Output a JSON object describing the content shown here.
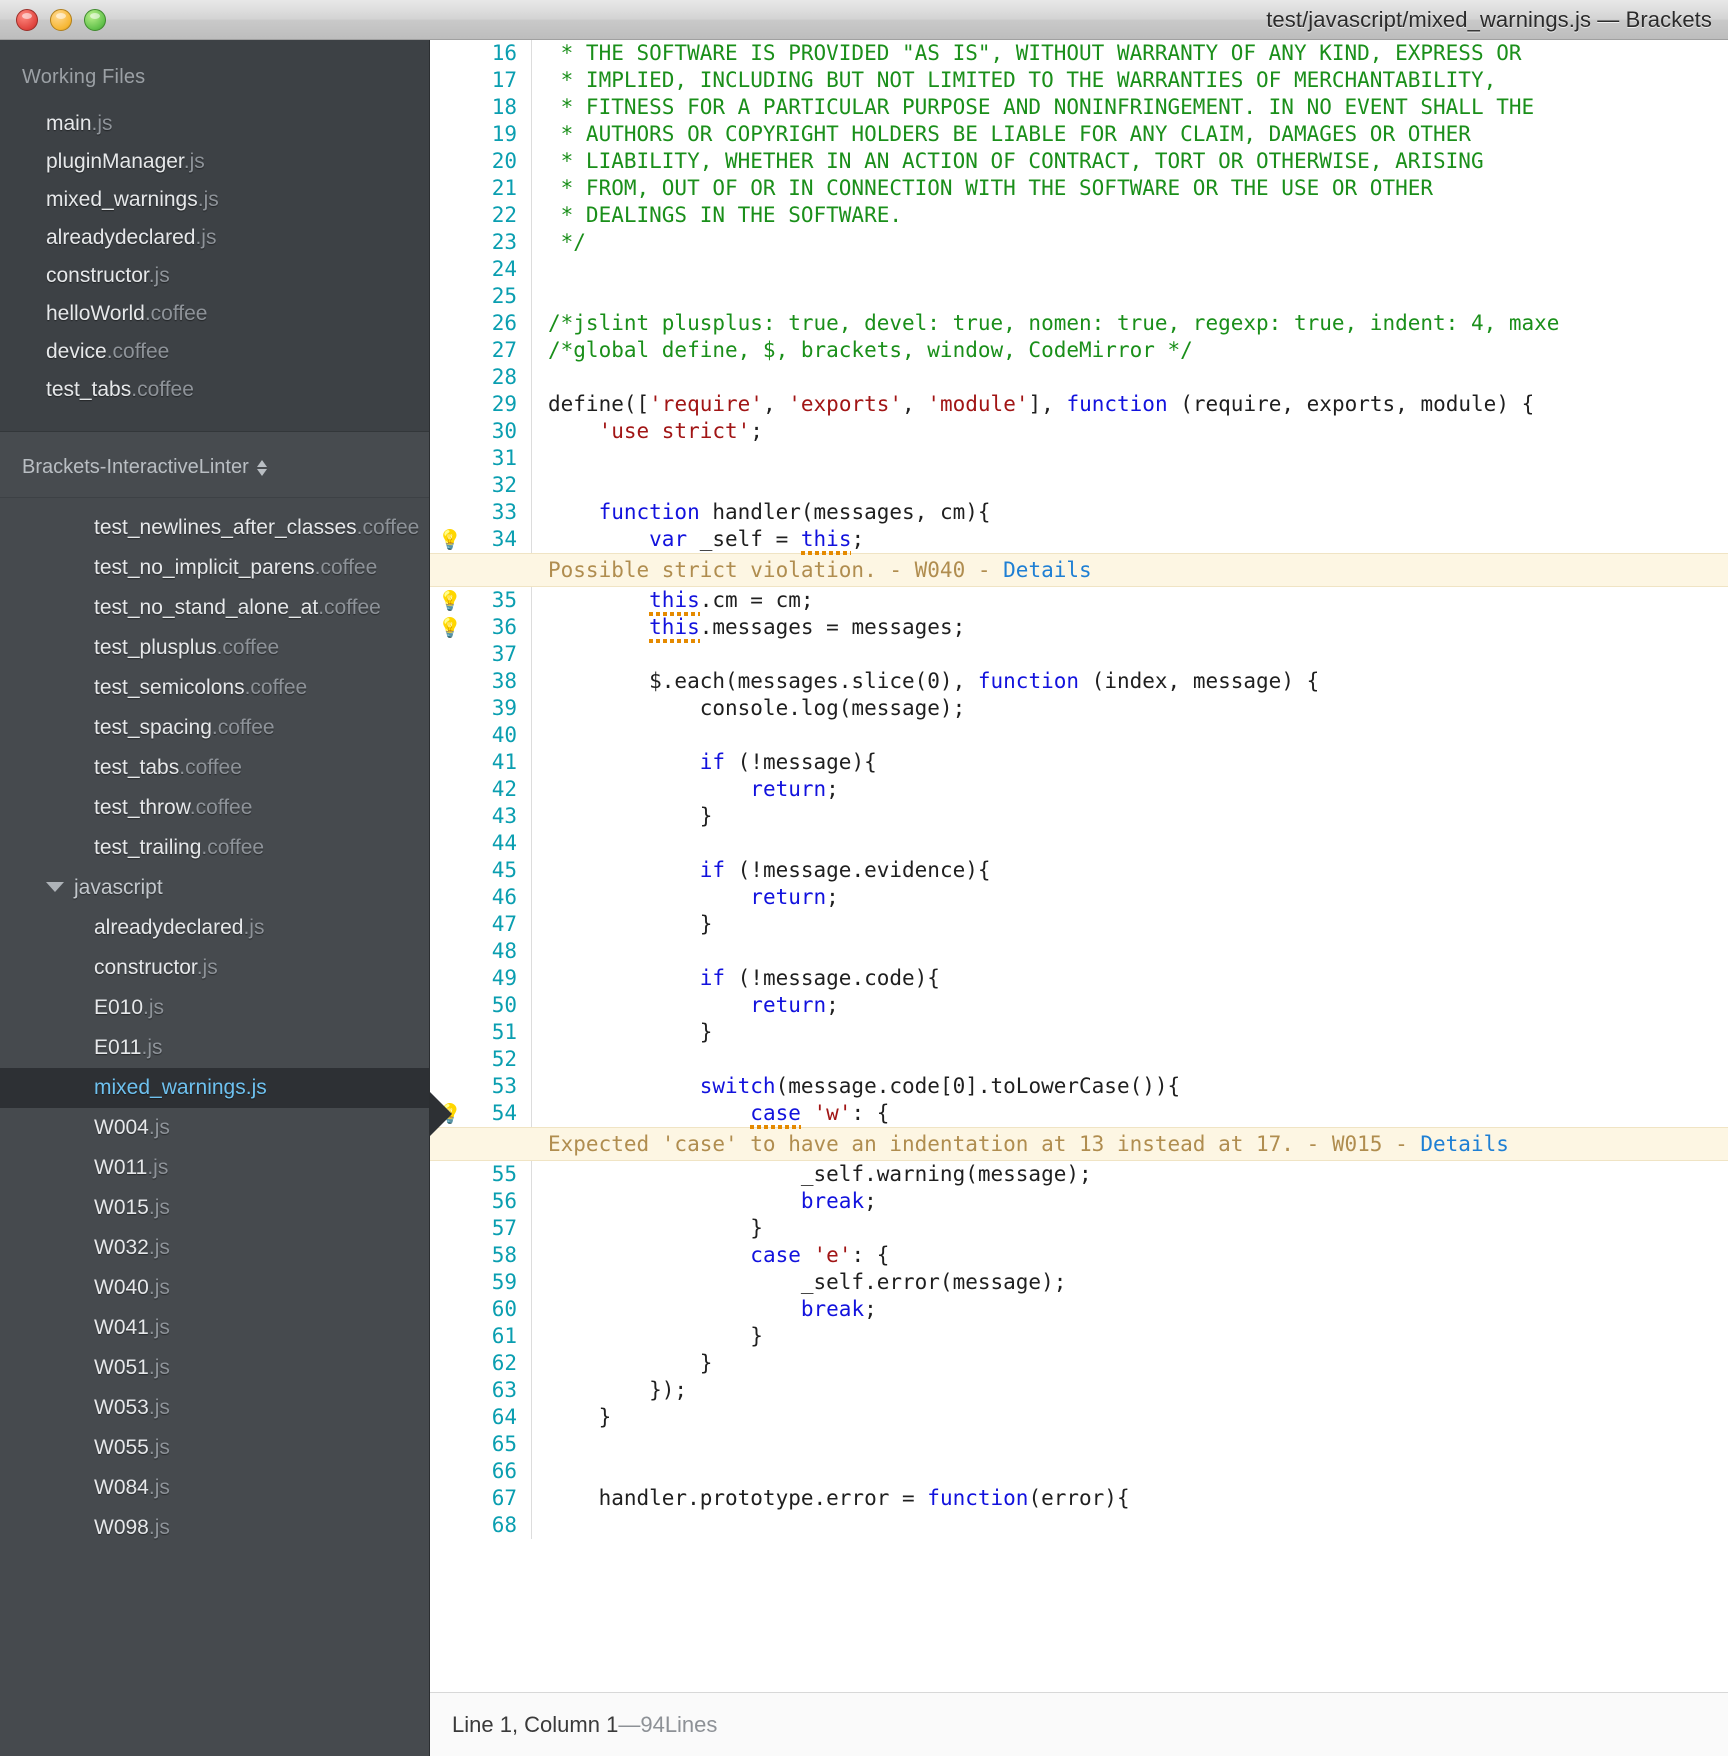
{
  "window": {
    "title": "test/javascript/mixed_warnings.js — Brackets",
    "controls": [
      "close",
      "minimize",
      "zoom"
    ]
  },
  "sidebar": {
    "working_files": {
      "title": "Working Files",
      "items": [
        {
          "name": "main",
          "ext": ".js"
        },
        {
          "name": "pluginManager",
          "ext": ".js"
        },
        {
          "name": "mixed_warnings",
          "ext": ".js"
        },
        {
          "name": "alreadydeclared",
          "ext": ".js"
        },
        {
          "name": "constructor",
          "ext": ".js"
        },
        {
          "name": "helloWorld",
          "ext": ".coffee"
        },
        {
          "name": "device",
          "ext": ".coffee"
        },
        {
          "name": "test_tabs",
          "ext": ".coffee"
        }
      ]
    },
    "project": {
      "title": "Brackets-InteractiveLinter",
      "items": [
        {
          "name": "test_newlines_after_classes",
          "ext": ".coffee",
          "type": "file",
          "selected": false
        },
        {
          "name": "test_no_implicit_parens",
          "ext": ".coffee",
          "type": "file",
          "selected": false
        },
        {
          "name": "test_no_stand_alone_at",
          "ext": ".coffee",
          "type": "file",
          "selected": false
        },
        {
          "name": "test_plusplus",
          "ext": ".coffee",
          "type": "file",
          "selected": false
        },
        {
          "name": "test_semicolons",
          "ext": ".coffee",
          "type": "file",
          "selected": false
        },
        {
          "name": "test_spacing",
          "ext": ".coffee",
          "type": "file",
          "selected": false
        },
        {
          "name": "test_tabs",
          "ext": ".coffee",
          "type": "file",
          "selected": false
        },
        {
          "name": "test_throw",
          "ext": ".coffee",
          "type": "file",
          "selected": false
        },
        {
          "name": "test_trailing",
          "ext": ".coffee",
          "type": "file",
          "selected": false
        },
        {
          "name": "javascript",
          "ext": "",
          "type": "folder",
          "expanded": true,
          "selected": false
        },
        {
          "name": "alreadydeclared",
          "ext": ".js",
          "type": "file",
          "selected": false
        },
        {
          "name": "constructor",
          "ext": ".js",
          "type": "file",
          "selected": false
        },
        {
          "name": "E010",
          "ext": ".js",
          "type": "file",
          "selected": false
        },
        {
          "name": "E011",
          "ext": ".js",
          "type": "file",
          "selected": false
        },
        {
          "name": "mixed_warnings",
          "ext": ".js",
          "type": "file",
          "selected": true
        },
        {
          "name": "W004",
          "ext": ".js",
          "type": "file",
          "selected": false
        },
        {
          "name": "W011",
          "ext": ".js",
          "type": "file",
          "selected": false
        },
        {
          "name": "W015",
          "ext": ".js",
          "type": "file",
          "selected": false
        },
        {
          "name": "W032",
          "ext": ".js",
          "type": "file",
          "selected": false
        },
        {
          "name": "W040",
          "ext": ".js",
          "type": "file",
          "selected": false
        },
        {
          "name": "W041",
          "ext": ".js",
          "type": "file",
          "selected": false
        },
        {
          "name": "W051",
          "ext": ".js",
          "type": "file",
          "selected": false
        },
        {
          "name": "W053",
          "ext": ".js",
          "type": "file",
          "selected": false
        },
        {
          "name": "W055",
          "ext": ".js",
          "type": "file",
          "selected": false
        },
        {
          "name": "W084",
          "ext": ".js",
          "type": "file",
          "selected": false
        },
        {
          "name": "W098",
          "ext": ".js",
          "type": "file",
          "selected": false
        }
      ]
    }
  },
  "editor": {
    "lines": [
      {
        "n": 16,
        "bulb": false,
        "tokens": [
          {
            "t": " * THE SOFTWARE IS PROVIDED \"AS IS\", WITHOUT WARRANTY OF ANY KIND, EXPRESS OR",
            "c": "cm"
          }
        ]
      },
      {
        "n": 17,
        "bulb": false,
        "tokens": [
          {
            "t": " * IMPLIED, INCLUDING BUT NOT LIMITED TO THE WARRANTIES OF MERCHANTABILITY,",
            "c": "cm"
          }
        ]
      },
      {
        "n": 18,
        "bulb": false,
        "tokens": [
          {
            "t": " * FITNESS FOR A PARTICULAR PURPOSE AND NONINFRINGEMENT. IN NO EVENT SHALL THE",
            "c": "cm"
          }
        ]
      },
      {
        "n": 19,
        "bulb": false,
        "tokens": [
          {
            "t": " * AUTHORS OR COPYRIGHT HOLDERS BE LIABLE FOR ANY CLAIM, DAMAGES OR OTHER",
            "c": "cm"
          }
        ]
      },
      {
        "n": 20,
        "bulb": false,
        "tokens": [
          {
            "t": " * LIABILITY, WHETHER IN AN ACTION OF CONTRACT, TORT OR OTHERWISE, ARISING",
            "c": "cm"
          }
        ]
      },
      {
        "n": 21,
        "bulb": false,
        "tokens": [
          {
            "t": " * FROM, OUT OF OR IN CONNECTION WITH THE SOFTWARE OR THE USE OR OTHER",
            "c": "cm"
          }
        ]
      },
      {
        "n": 22,
        "bulb": false,
        "tokens": [
          {
            "t": " * DEALINGS IN THE SOFTWARE.",
            "c": "cm"
          }
        ]
      },
      {
        "n": 23,
        "bulb": false,
        "tokens": [
          {
            "t": " */",
            "c": "cm"
          }
        ]
      },
      {
        "n": 24,
        "bulb": false,
        "tokens": []
      },
      {
        "n": 25,
        "bulb": false,
        "tokens": []
      },
      {
        "n": 26,
        "bulb": false,
        "tokens": [
          {
            "t": "/*jslint plusplus: true, devel: true, nomen: true, regexp: true, indent: 4, maxe",
            "c": "cm"
          }
        ]
      },
      {
        "n": 27,
        "bulb": false,
        "tokens": [
          {
            "t": "/*global define, $, brackets, window, CodeMirror */",
            "c": "cm"
          }
        ]
      },
      {
        "n": 28,
        "bulb": false,
        "tokens": []
      },
      {
        "n": 29,
        "bulb": false,
        "tokens": [
          {
            "t": "define([",
            "c": "plain"
          },
          {
            "t": "'require'",
            "c": "str"
          },
          {
            "t": ", ",
            "c": "plain"
          },
          {
            "t": "'exports'",
            "c": "str"
          },
          {
            "t": ", ",
            "c": "plain"
          },
          {
            "t": "'module'",
            "c": "str"
          },
          {
            "t": "], ",
            "c": "plain"
          },
          {
            "t": "function",
            "c": "kw"
          },
          {
            "t": " (require, exports, module) {",
            "c": "plain"
          }
        ]
      },
      {
        "n": 30,
        "bulb": false,
        "tokens": [
          {
            "t": "    ",
            "c": "plain"
          },
          {
            "t": "'use strict'",
            "c": "str"
          },
          {
            "t": ";",
            "c": "plain"
          }
        ]
      },
      {
        "n": 31,
        "bulb": false,
        "tokens": []
      },
      {
        "n": 32,
        "bulb": false,
        "tokens": []
      },
      {
        "n": 33,
        "bulb": false,
        "tokens": [
          {
            "t": "    ",
            "c": "plain"
          },
          {
            "t": "function",
            "c": "kw"
          },
          {
            "t": " handler(messages, cm){",
            "c": "plain"
          }
        ]
      },
      {
        "n": 34,
        "bulb": true,
        "tokens": [
          {
            "t": "        ",
            "c": "plain"
          },
          {
            "t": "var",
            "c": "kw"
          },
          {
            "t": " _self = ",
            "c": "plain"
          },
          {
            "t": "this",
            "c": "kw",
            "squiggly": true
          },
          {
            "t": ";",
            "c": "plain"
          }
        ]
      },
      {
        "n": 35,
        "bulb": true,
        "tokens": [
          {
            "t": "        ",
            "c": "plain"
          },
          {
            "t": "this",
            "c": "kw",
            "squiggly": true
          },
          {
            "t": ".cm = cm;",
            "c": "plain"
          }
        ]
      },
      {
        "n": 36,
        "bulb": true,
        "tokens": [
          {
            "t": "        ",
            "c": "plain"
          },
          {
            "t": "this",
            "c": "kw",
            "squiggly": true
          },
          {
            "t": ".messages = messages;",
            "c": "plain"
          }
        ]
      },
      {
        "n": 37,
        "bulb": false,
        "tokens": []
      },
      {
        "n": 38,
        "bulb": false,
        "tokens": [
          {
            "t": "        $.each(messages.slice(0), ",
            "c": "plain"
          },
          {
            "t": "function",
            "c": "kw"
          },
          {
            "t": " (index, message) {",
            "c": "plain"
          }
        ]
      },
      {
        "n": 39,
        "bulb": false,
        "tokens": [
          {
            "t": "            console.log(message);",
            "c": "plain"
          }
        ]
      },
      {
        "n": 40,
        "bulb": false,
        "tokens": []
      },
      {
        "n": 41,
        "bulb": false,
        "tokens": [
          {
            "t": "            ",
            "c": "plain"
          },
          {
            "t": "if",
            "c": "kw"
          },
          {
            "t": " (!message){",
            "c": "plain"
          }
        ]
      },
      {
        "n": 42,
        "bulb": false,
        "tokens": [
          {
            "t": "                ",
            "c": "plain"
          },
          {
            "t": "return",
            "c": "kw"
          },
          {
            "t": ";",
            "c": "plain"
          }
        ]
      },
      {
        "n": 43,
        "bulb": false,
        "tokens": [
          {
            "t": "            }",
            "c": "plain"
          }
        ]
      },
      {
        "n": 44,
        "bulb": false,
        "tokens": []
      },
      {
        "n": 45,
        "bulb": false,
        "tokens": [
          {
            "t": "            ",
            "c": "plain"
          },
          {
            "t": "if",
            "c": "kw"
          },
          {
            "t": " (!message.evidence){",
            "c": "plain"
          }
        ]
      },
      {
        "n": 46,
        "bulb": false,
        "tokens": [
          {
            "t": "                ",
            "c": "plain"
          },
          {
            "t": "return",
            "c": "kw"
          },
          {
            "t": ";",
            "c": "plain"
          }
        ]
      },
      {
        "n": 47,
        "bulb": false,
        "tokens": [
          {
            "t": "            }",
            "c": "plain"
          }
        ]
      },
      {
        "n": 48,
        "bulb": false,
        "tokens": []
      },
      {
        "n": 49,
        "bulb": false,
        "tokens": [
          {
            "t": "            ",
            "c": "plain"
          },
          {
            "t": "if",
            "c": "kw"
          },
          {
            "t": " (!message.code){",
            "c": "plain"
          }
        ]
      },
      {
        "n": 50,
        "bulb": false,
        "tokens": [
          {
            "t": "                ",
            "c": "plain"
          },
          {
            "t": "return",
            "c": "kw"
          },
          {
            "t": ";",
            "c": "plain"
          }
        ]
      },
      {
        "n": 51,
        "bulb": false,
        "tokens": [
          {
            "t": "            }",
            "c": "plain"
          }
        ]
      },
      {
        "n": 52,
        "bulb": false,
        "tokens": []
      },
      {
        "n": 53,
        "bulb": false,
        "tokens": [
          {
            "t": "            ",
            "c": "plain"
          },
          {
            "t": "switch",
            "c": "kw"
          },
          {
            "t": "(message.code[0].toLowerCase()){",
            "c": "plain"
          }
        ]
      },
      {
        "n": 54,
        "bulb": true,
        "tokens": [
          {
            "t": "                ",
            "c": "plain"
          },
          {
            "t": "case",
            "c": "kw",
            "squiggly": true
          },
          {
            "t": " ",
            "c": "plain"
          },
          {
            "t": "'w'",
            "c": "str"
          },
          {
            "t": ": {",
            "c": "plain"
          }
        ]
      },
      {
        "n": 55,
        "bulb": false,
        "tokens": [
          {
            "t": "                    _self.warning(message);",
            "c": "plain"
          }
        ]
      },
      {
        "n": 56,
        "bulb": false,
        "tokens": [
          {
            "t": "                    ",
            "c": "plain"
          },
          {
            "t": "break",
            "c": "kw"
          },
          {
            "t": ";",
            "c": "plain"
          }
        ]
      },
      {
        "n": 57,
        "bulb": false,
        "tokens": [
          {
            "t": "                }",
            "c": "plain"
          }
        ]
      },
      {
        "n": 58,
        "bulb": false,
        "tokens": [
          {
            "t": "                ",
            "c": "plain"
          },
          {
            "t": "case",
            "c": "kw"
          },
          {
            "t": " ",
            "c": "plain"
          },
          {
            "t": "'e'",
            "c": "str"
          },
          {
            "t": ": {",
            "c": "plain"
          }
        ]
      },
      {
        "n": 59,
        "bulb": false,
        "tokens": [
          {
            "t": "                    _self.error(message);",
            "c": "plain"
          }
        ]
      },
      {
        "n": 60,
        "bulb": false,
        "tokens": [
          {
            "t": "                    ",
            "c": "plain"
          },
          {
            "t": "break",
            "c": "kw"
          },
          {
            "t": ";",
            "c": "plain"
          }
        ]
      },
      {
        "n": 61,
        "bulb": false,
        "tokens": [
          {
            "t": "                }",
            "c": "plain"
          }
        ]
      },
      {
        "n": 62,
        "bulb": false,
        "tokens": [
          {
            "t": "            }",
            "c": "plain"
          }
        ]
      },
      {
        "n": 63,
        "bulb": false,
        "tokens": [
          {
            "t": "        });",
            "c": "plain"
          }
        ]
      },
      {
        "n": 64,
        "bulb": false,
        "tokens": [
          {
            "t": "    }",
            "c": "plain"
          }
        ]
      },
      {
        "n": 65,
        "bulb": false,
        "tokens": []
      },
      {
        "n": 66,
        "bulb": false,
        "tokens": []
      },
      {
        "n": 67,
        "bulb": false,
        "tokens": [
          {
            "t": "    handler.prototype.error = ",
            "c": "plain"
          },
          {
            "t": "function",
            "c": "kw"
          },
          {
            "t": "(error){",
            "c": "plain"
          }
        ]
      },
      {
        "n": 68,
        "bulb": false,
        "tokens": []
      }
    ],
    "warnings": [
      {
        "after_line": 34,
        "message": "Possible strict violation. - W040 - ",
        "link": "Details"
      },
      {
        "after_line": 54,
        "message": "Expected 'case' to have an indentation at 13 instead at 17. - W015 - ",
        "link": "Details"
      }
    ]
  },
  "statusbar": {
    "position": "Line 1, Column 1",
    "separator": " — ",
    "lines_count": "94",
    "lines_label": " Lines"
  },
  "colors": {
    "comment": "#1a8f1a",
    "keyword": "#1212dd",
    "string": "#a11515",
    "linenumber": "#0a9eb0",
    "warning_bg": "#fdf6e3",
    "warning_text": "#b08d4f",
    "link": "#1e7fd4",
    "selected_file": "#6ec1ef",
    "sidebar_bg": "#464a4e"
  }
}
